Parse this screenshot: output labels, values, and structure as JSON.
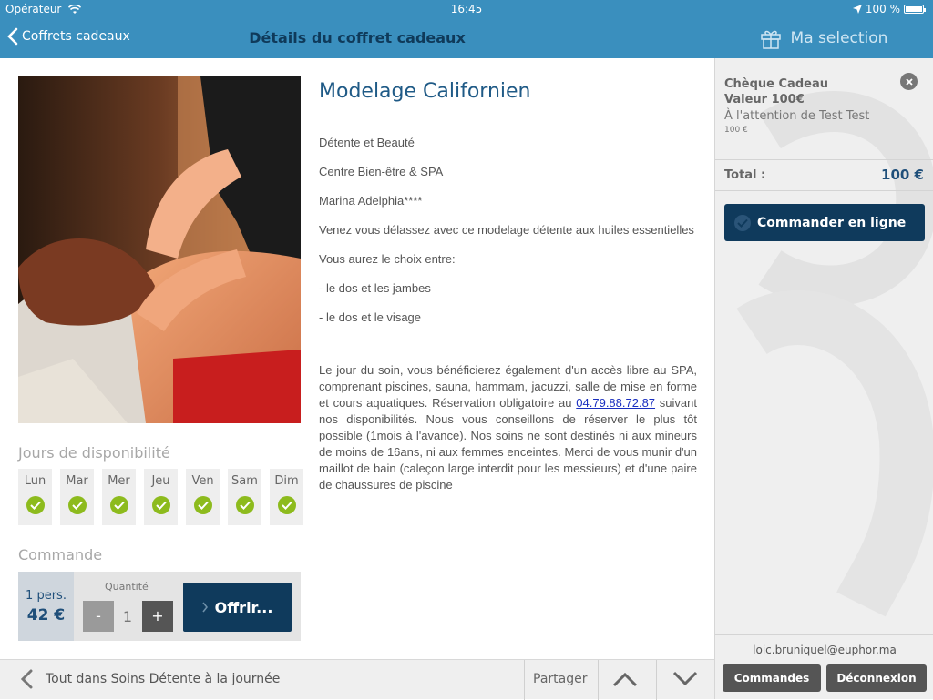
{
  "status_bar": {
    "carrier": "Opérateur",
    "time": "16:45",
    "battery": "100 %"
  },
  "nav": {
    "back_label": "Coffrets cadeaux",
    "title": "Détails du coffret cadeaux",
    "selection_title": "Ma selection"
  },
  "product": {
    "title": "Modelage Californien",
    "category": "Détente et Beauté",
    "type": "Centre Bien-être & SPA",
    "place": "Marina Adelphia****",
    "intro": "Venez vous délassez avec ce modelage détente aux huiles essentielles",
    "choice_intro": "Vous aurez le choix entre:",
    "choice_1": "- le dos et les jambes",
    "choice_2": "- le dos et le visage",
    "long_text_1": "Le jour du soin, vous bénéficierez également d'un accès libre au SPA, comprenant piscines, sauna, hammam, jacuzzi, salle de mise en forme et cours aquatiques. Réservation obligatoire au ",
    "phone": "04.79.88.72.87",
    "long_text_2": " suivant nos disponibilités. Nous vous conseillons de réserver le plus tôt possible (1mois à l'avance). Nos soins ne sont destinés ni aux mineurs de moins de 16ans, ni aux femmes enceintes. Merci de vous munir d'un maillot de bain (caleçon large interdit pour les messieurs) et d'une paire de chaussures de piscine"
  },
  "availability": {
    "label": "Jours de disponibilité",
    "days": [
      {
        "label": "Lun",
        "available": true
      },
      {
        "label": "Mar",
        "available": true
      },
      {
        "label": "Mer",
        "available": true
      },
      {
        "label": "Jeu",
        "available": true
      },
      {
        "label": "Ven",
        "available": true
      },
      {
        "label": "Sam",
        "available": true
      },
      {
        "label": "Dim",
        "available": true
      }
    ]
  },
  "order": {
    "label": "Commande",
    "persons": "1 pers.",
    "price": "42 €",
    "quantity_label": "Quantité",
    "quantity": "1",
    "minus": "-",
    "plus": "+",
    "offer_button": "Offrir..."
  },
  "bottom_bar": {
    "back_label": "Tout dans  Soins Détente à la journée",
    "share": "Partager"
  },
  "selection": {
    "item_name": "Chèque Cadeau Valeur 100€",
    "item_recipient": "À l'attention de Test Test",
    "item_price": "100 €",
    "total_label": "Total :",
    "total_value": "100 €",
    "order_online": "Commander en ligne",
    "email": "loic.bruniquel@euphor.ma",
    "orders_button": "Commandes",
    "logout_button": "Déconnexion"
  },
  "colors": {
    "nav": "#3a8fbe",
    "dark_button": "#0f3a5c",
    "check": "#8dbb1d",
    "title": "#1f5a86"
  }
}
